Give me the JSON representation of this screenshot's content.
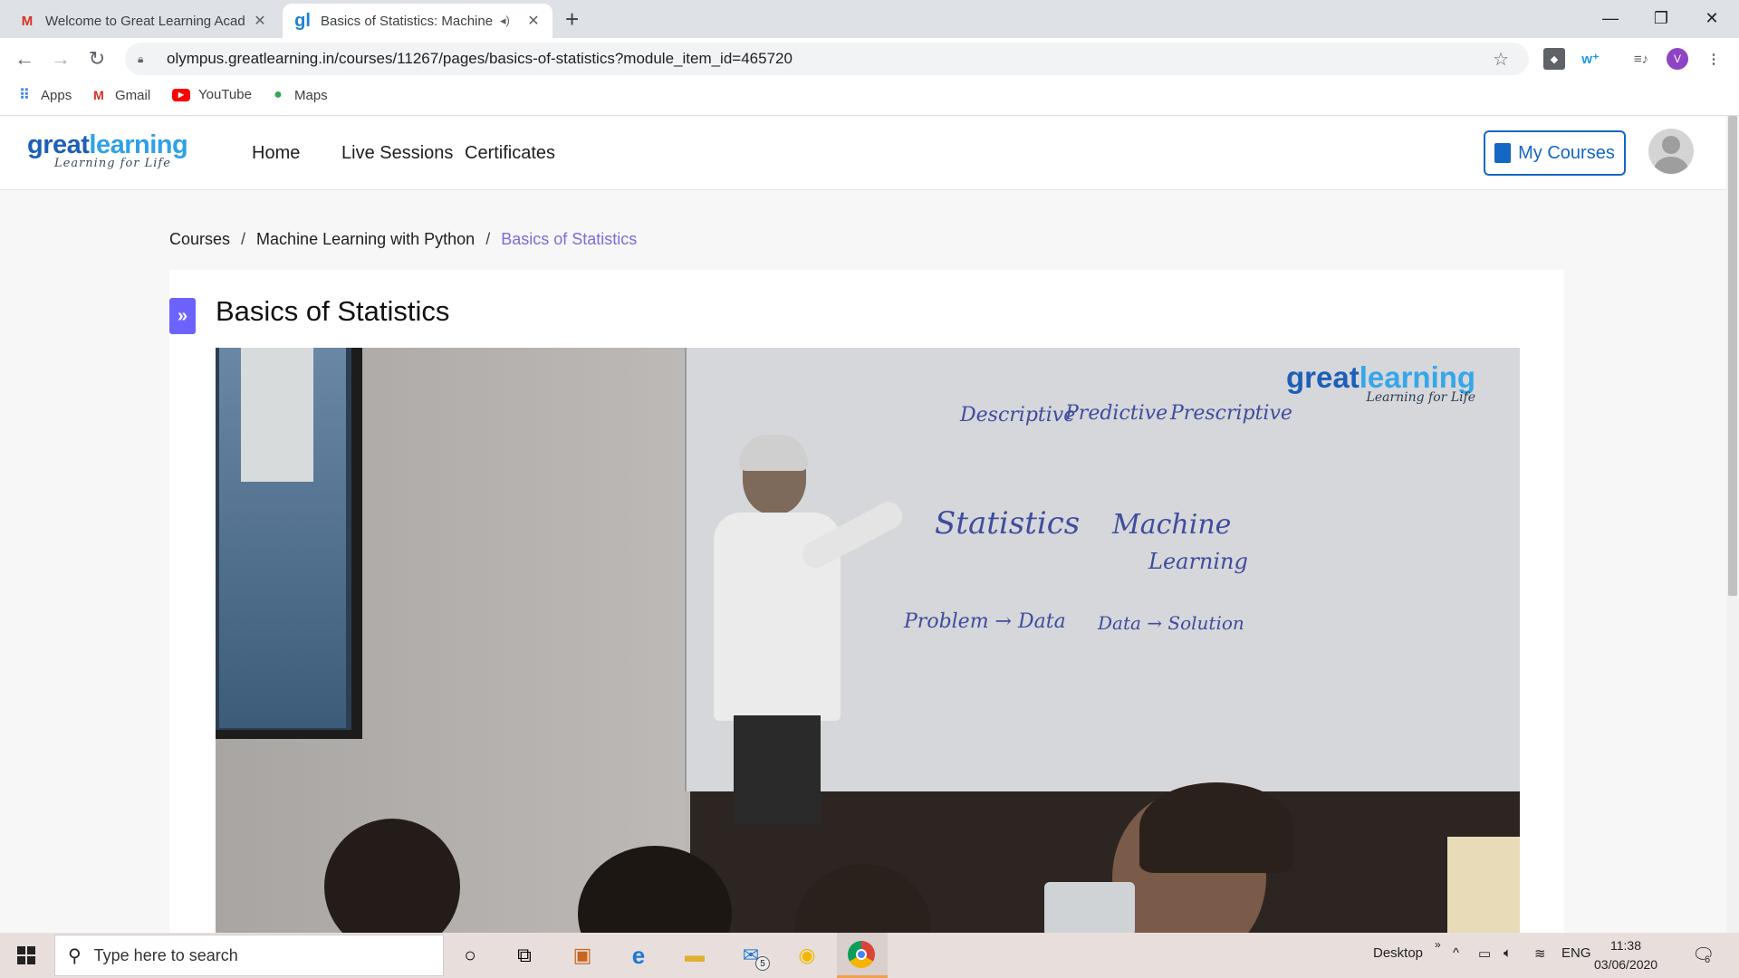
{
  "browser": {
    "tabs": [
      {
        "title": "Welcome to Great Learning Acad",
        "favicon": "gmail-icon"
      },
      {
        "title": "Basics of Statistics: Machine",
        "favicon": "greatlearning-icon",
        "audio": true
      }
    ],
    "url": "olympus.greatlearning.in/courses/11267/pages/basics-of-statistics?module_item_id=465720",
    "profile_initial": "V",
    "bookmarks": [
      {
        "label": "Apps",
        "icon": "apps-grid-icon"
      },
      {
        "label": "Gmail",
        "icon": "gmail-icon"
      },
      {
        "label": "YouTube",
        "icon": "youtube-icon"
      },
      {
        "label": "Maps",
        "icon": "maps-pin-icon"
      }
    ]
  },
  "site": {
    "logo_word_1": "great",
    "logo_word_2": "learning",
    "logo_tagline": "Learning for Life",
    "nav": [
      "Home",
      "Live Sessions",
      "Certificates"
    ],
    "my_courses_label": "My Courses"
  },
  "breadcrumb": {
    "items": [
      "Courses",
      "Machine Learning with Python"
    ],
    "current": "Basics of Statistics",
    "separator": "/"
  },
  "page": {
    "title": "Basics of Statistics",
    "expand_glyph": "»"
  },
  "video": {
    "watermark_word_1": "great",
    "watermark_word_2": "learning",
    "watermark_tagline": "Learning for Life",
    "board_text": {
      "line1_a": "Descriptive",
      "line1_b": "Predictive",
      "line1_c": "Prescriptive",
      "statistics": "Statistics",
      "machine": "Machine",
      "learning": "Learning",
      "left_flow": "Problem → Data",
      "right_flow": "Data → Solution"
    }
  },
  "taskbar": {
    "search_placeholder": "Type here to search",
    "mail_badge": "5",
    "desktop_label": "Desktop",
    "language": "ENG",
    "time": "11:38",
    "date": "03/06/2020",
    "notification_count": "6"
  },
  "colors": {
    "brand_blue": "#1467c4",
    "breadcrumb_current": "#7b6cdb",
    "expand_button": "#6c63ff"
  }
}
